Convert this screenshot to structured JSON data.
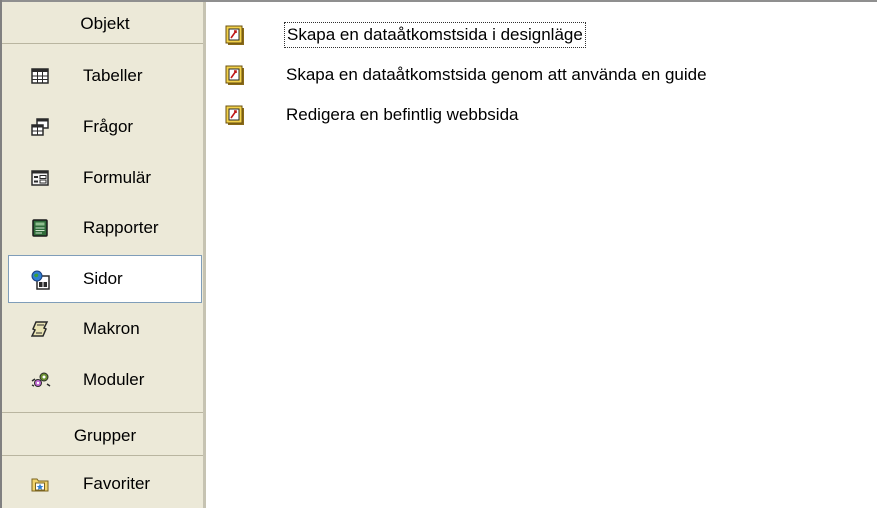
{
  "sidebar": {
    "objects_header": "Objekt",
    "items": [
      {
        "label": "Tabeller",
        "icon": "table-icon"
      },
      {
        "label": "Frågor",
        "icon": "query-icon"
      },
      {
        "label": "Formulär",
        "icon": "form-icon"
      },
      {
        "label": "Rapporter",
        "icon": "report-icon"
      },
      {
        "label": "Sidor",
        "icon": "page-icon",
        "selected": true
      },
      {
        "label": "Makron",
        "icon": "macro-icon"
      },
      {
        "label": "Moduler",
        "icon": "module-icon"
      }
    ],
    "groups_header": "Grupper",
    "group_items": [
      {
        "label": "Favoriter",
        "icon": "favorites-folder-icon"
      }
    ]
  },
  "content": {
    "entries": [
      {
        "label": "Skapa en dataåtkomstsida i designläge",
        "icon": "data-access-page-icon",
        "focused": true
      },
      {
        "label": "Skapa en dataåtkomstsida genom att använda en guide",
        "icon": "data-access-page-icon"
      },
      {
        "label": "Redigera en befintlig webbsida",
        "icon": "data-access-page-icon"
      }
    ]
  },
  "colors": {
    "sidebar_bg": "#ece9d8",
    "selection_border": "#7f9db9",
    "focus_outline": "#303030"
  }
}
